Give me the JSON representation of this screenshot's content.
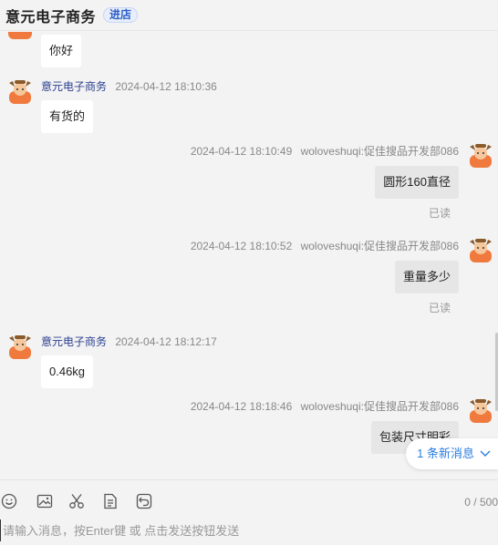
{
  "header": {
    "shop_name": "意元电子商务",
    "enter_shop": "进店"
  },
  "messages": [
    {
      "side": "left",
      "text": "你好"
    },
    {
      "side": "left",
      "sender": "意元电子商务",
      "time": "2024-04-12 18:10:36",
      "text": "有货的"
    },
    {
      "side": "right",
      "sender": "woloveshuqi:促佳搜品开发部086",
      "time": "2024-04-12 18:10:49",
      "text": "圆形160直径",
      "status": "已读"
    },
    {
      "side": "right",
      "sender": "woloveshuqi:促佳搜品开发部086",
      "time": "2024-04-12 18:10:52",
      "text": "重量多少",
      "status": "已读"
    },
    {
      "side": "left",
      "sender": "意元电子商务",
      "time": "2024-04-12 18:12:17",
      "text": "0.46kg"
    },
    {
      "side": "right",
      "sender": "woloveshuqi:促佳搜品开发部086",
      "time": "2024-04-12 18:18:46",
      "text": "包装尺寸明彩"
    }
  ],
  "new_messages": {
    "label": "1 条新消息"
  },
  "toolbar": {
    "tools": [
      "emoji-icon",
      "image-icon",
      "scissors-icon",
      "document-icon",
      "recall-icon"
    ],
    "counter": "0 / 500"
  },
  "input": {
    "placeholder": "请输入消息，按Enter键 或 点击发送按钮发送",
    "value": ""
  }
}
